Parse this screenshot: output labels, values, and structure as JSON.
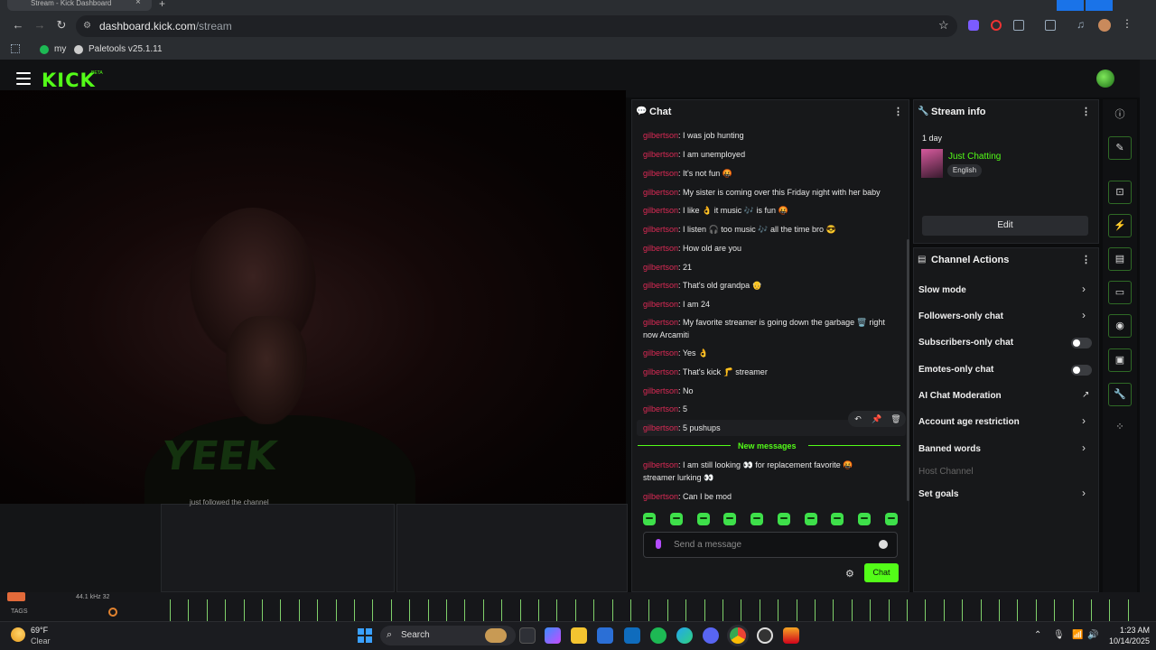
{
  "browser": {
    "tab_title": "Stream - Kick Dashboard",
    "url_host": "dashboard.kick.com",
    "url_path": "/stream",
    "bookmarks": [
      "my",
      "Paletools v25.1.11"
    ]
  },
  "header": {
    "logo": "KICK",
    "logo_badge": "BETA"
  },
  "video": {
    "shirt_text": "YEEK"
  },
  "activity": {
    "followed_text": "just followed the channel"
  },
  "chat": {
    "title": "Chat",
    "messages": [
      {
        "user": "gilbertson",
        "text": ": I was job hunting"
      },
      {
        "user": "gilbertson",
        "text": ": I am unemployed"
      },
      {
        "user": "gilbertson",
        "text": ": It's not fun 🤬"
      },
      {
        "user": "gilbertson",
        "text": ": My sister is coming over this Friday night with her baby"
      },
      {
        "user": "gilbertson",
        "text": ": I like 👌 it music 🎶 is fun 🤬"
      },
      {
        "user": "gilbertson",
        "text": ": I listen 🎧 too music 🎶 all the time bro 😎"
      },
      {
        "user": "gilbertson",
        "text": ": How old are you"
      },
      {
        "user": "gilbertson",
        "text": ": 21"
      },
      {
        "user": "gilbertson",
        "text": ": That's old grandpa 👴"
      },
      {
        "user": "gilbertson",
        "text": ": I am 24"
      },
      {
        "user": "gilbertson",
        "text": ": My favorite streamer is going down the garbage 🗑️ right now Arcamiti"
      },
      {
        "user": "gilbertson",
        "text": ": Yes 👌"
      },
      {
        "user": "gilbertson",
        "text": ": That's kick 🦵 streamer"
      },
      {
        "user": "gilbertson",
        "text": ": No"
      },
      {
        "user": "gilbertson",
        "text": ": 5"
      },
      {
        "user": "gilbertson",
        "text": ": 5 pushups"
      }
    ],
    "new_messages_label": "New messages",
    "new_messages": [
      {
        "user": "gilbertson",
        "text": ": I am still looking 👀 for replacement favorite 🤬 streamer lurking 👀"
      },
      {
        "user": "gilbertson",
        "text": ": Can I be mod"
      }
    ],
    "input_placeholder": "Send a message",
    "send_label": "Chat"
  },
  "stream_info": {
    "title": "Stream info",
    "uptime": "1 day",
    "category": "Just Chatting",
    "language": "English",
    "edit_label": "Edit"
  },
  "channel_actions": {
    "title": "Channel Actions",
    "items": [
      {
        "label": "Slow mode",
        "control": "chevron"
      },
      {
        "label": "Followers-only chat",
        "control": "chevron"
      },
      {
        "label": "Subscribers-only chat",
        "control": "toggle"
      },
      {
        "label": "Emotes-only chat",
        "control": "toggle"
      },
      {
        "label": "AI Chat Moderation",
        "control": "external"
      },
      {
        "label": "Account age restriction",
        "control": "chevron"
      },
      {
        "label": "Banned words",
        "control": "chevron"
      },
      {
        "label": "Host Channel",
        "control": "none"
      },
      {
        "label": "Set goals",
        "control": "chevron"
      }
    ]
  },
  "obs": {
    "audio_info": "44.1 kHz 32",
    "tags_label": "TAGS"
  },
  "taskbar": {
    "temperature": "69°F",
    "condition": "Clear",
    "search_label": "Search",
    "time": "1:23 AM",
    "date": "10/14/2025"
  },
  "colors": {
    "accent": "#53fc18",
    "username": "#dc2a55",
    "panel_bg": "#17181a"
  }
}
